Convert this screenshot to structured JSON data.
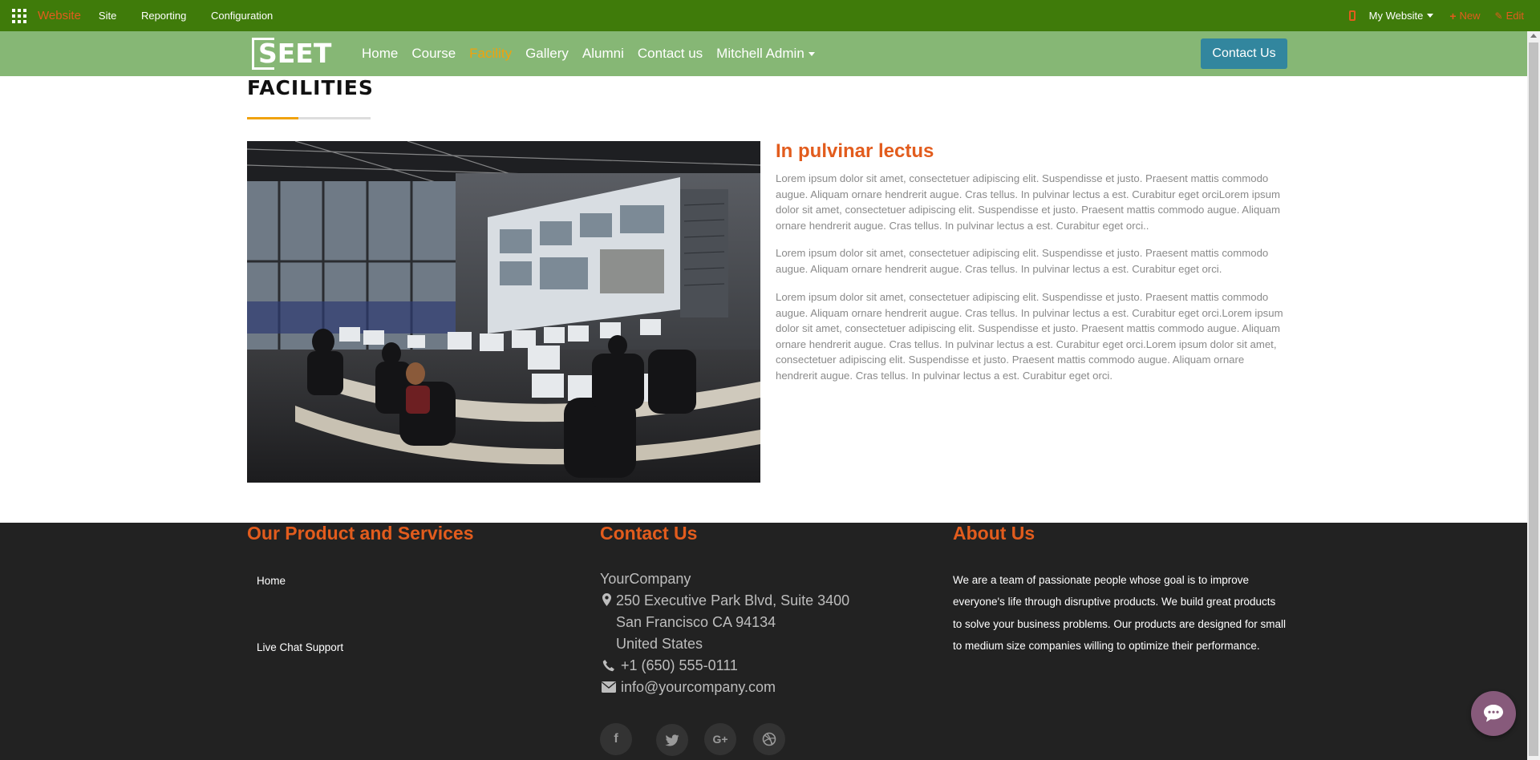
{
  "admin_bar": {
    "brand": "Website",
    "menu": [
      "Site",
      "Reporting",
      "Configuration"
    ],
    "website_selector": "My Website",
    "new_label": "New",
    "edit_label": "Edit"
  },
  "header": {
    "logo_text": "SEET",
    "nav": [
      "Home",
      "Course",
      "Facility",
      "Gallery",
      "Alumni",
      "Contact us"
    ],
    "active_nav": "Facility",
    "user_menu": "Mitchell Admin",
    "cta_button": "Contact Us"
  },
  "main": {
    "page_title": "FACILITIES",
    "article_heading": "In pulvinar lectus",
    "paragraphs": [
      "Lorem ipsum dolor sit amet, consectetuer adipiscing elit. Suspendisse et justo. Praesent mattis commodo augue. Aliquam ornare hendrerit augue. Cras tellus. In pulvinar lectus a est. Curabitur eget orciLorem ipsum dolor sit amet, consectetuer adipiscing elit. Suspendisse et justo. Praesent mattis commodo augue. Aliquam ornare hendrerit augue. Cras tellus. In pulvinar lectus a est. Curabitur eget orci..",
      "Lorem ipsum dolor sit amet, consectetuer adipiscing elit. Suspendisse et justo. Praesent mattis commodo augue. Aliquam ornare hendrerit augue. Cras tellus. In pulvinar lectus a est. Curabitur eget orci.",
      "Lorem ipsum dolor sit amet, consectetuer adipiscing elit. Suspendisse et justo. Praesent mattis commodo augue. Aliquam ornare hendrerit augue. Cras tellus. In pulvinar lectus a est. Curabitur eget orci.Lorem ipsum dolor sit amet, consectetuer adipiscing elit. Suspendisse et justo. Praesent mattis commodo augue. Aliquam ornare hendrerit augue. Cras tellus. In pulvinar lectus a est. Curabitur eget orci.Lorem ipsum dolor sit amet, consectetuer adipiscing elit. Suspendisse et justo. Praesent mattis commodo augue. Aliquam ornare hendrerit augue. Cras tellus. In pulvinar lectus a est. Curabitur eget orci."
    ]
  },
  "footer": {
    "products": {
      "heading": "Our Product and Services",
      "links": [
        "Home",
        "Live Chat Support"
      ]
    },
    "contact": {
      "heading": "Contact Us",
      "company": "YourCompany",
      "address": [
        "250 Executive Park Blvd, Suite 3400",
        "San Francisco CA 94134",
        "United States"
      ],
      "phone": "+1 (650) 555-0111",
      "email": "info@yourcompany.com",
      "social": [
        "facebook-icon",
        "twitter-icon",
        "google-plus-icon",
        "dribbble-icon"
      ]
    },
    "about": {
      "heading": "About Us",
      "text": "We are a team of passionate people whose goal is to improve everyone's life through disruptive products. We build great products to solve your business problems. Our products are designed for small to medium size companies willing to optimize their performance."
    }
  },
  "colors": {
    "admin_bar": "#3f7b0a",
    "header": "#86b775",
    "accent_orange": "#e25c1d",
    "active_nav": "#f0a20c",
    "cta": "#32869e",
    "footer": "#222222",
    "chat": "#875a7b"
  }
}
